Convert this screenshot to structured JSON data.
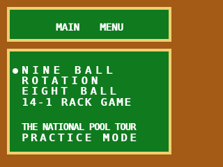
{
  "header": {
    "title_word1": "MAIN",
    "title_word2": "MENU"
  },
  "menu": {
    "items": [
      "NINE BALL",
      "ROTATION",
      "EIGHT BALL",
      "14-1 RACK GAME",
      "THE NATIONAL POOL TOUR",
      "PRACTICE MODE"
    ],
    "selected_index": 0
  },
  "colors": {
    "frame": "#a35b16",
    "panel_border": "#f0d070",
    "panel_fill": "#0f7a1e",
    "text": "#ffffff"
  },
  "icons": {
    "cursor": "white-ball-cursor"
  }
}
